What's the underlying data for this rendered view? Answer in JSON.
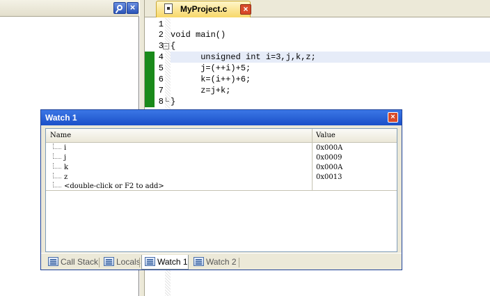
{
  "editor": {
    "tab_label": "MyProject.c",
    "lines": [
      {
        "num": "1",
        "code": ""
      },
      {
        "num": "2",
        "code": "void main()"
      },
      {
        "num": "3",
        "code": "{"
      },
      {
        "num": "4",
        "code": "      unsigned int i=3,j,k,z;"
      },
      {
        "num": "5",
        "code": "      j=(++i)+5;"
      },
      {
        "num": "6",
        "code": "      k=(i++)+6;"
      },
      {
        "num": "7",
        "code": "      z=j+k;"
      },
      {
        "num": "8",
        "code": "}"
      }
    ]
  },
  "watch": {
    "title": "Watch 1",
    "col_name": "Name",
    "col_value": "Value",
    "rows": [
      {
        "name": "i",
        "value": "0x000A"
      },
      {
        "name": "j",
        "value": "0x0009"
      },
      {
        "name": "k",
        "value": "0x000A"
      },
      {
        "name": "z",
        "value": "0x0013"
      },
      {
        "name": "<double-click or F2 to add>",
        "value": ""
      }
    ],
    "tabs": [
      "Call Stack",
      "Locals",
      "Watch 1",
      "Watch 2"
    ]
  },
  "icons": {
    "pin": "pin-icon",
    "close": "close-icon",
    "document": "document-icon"
  }
}
